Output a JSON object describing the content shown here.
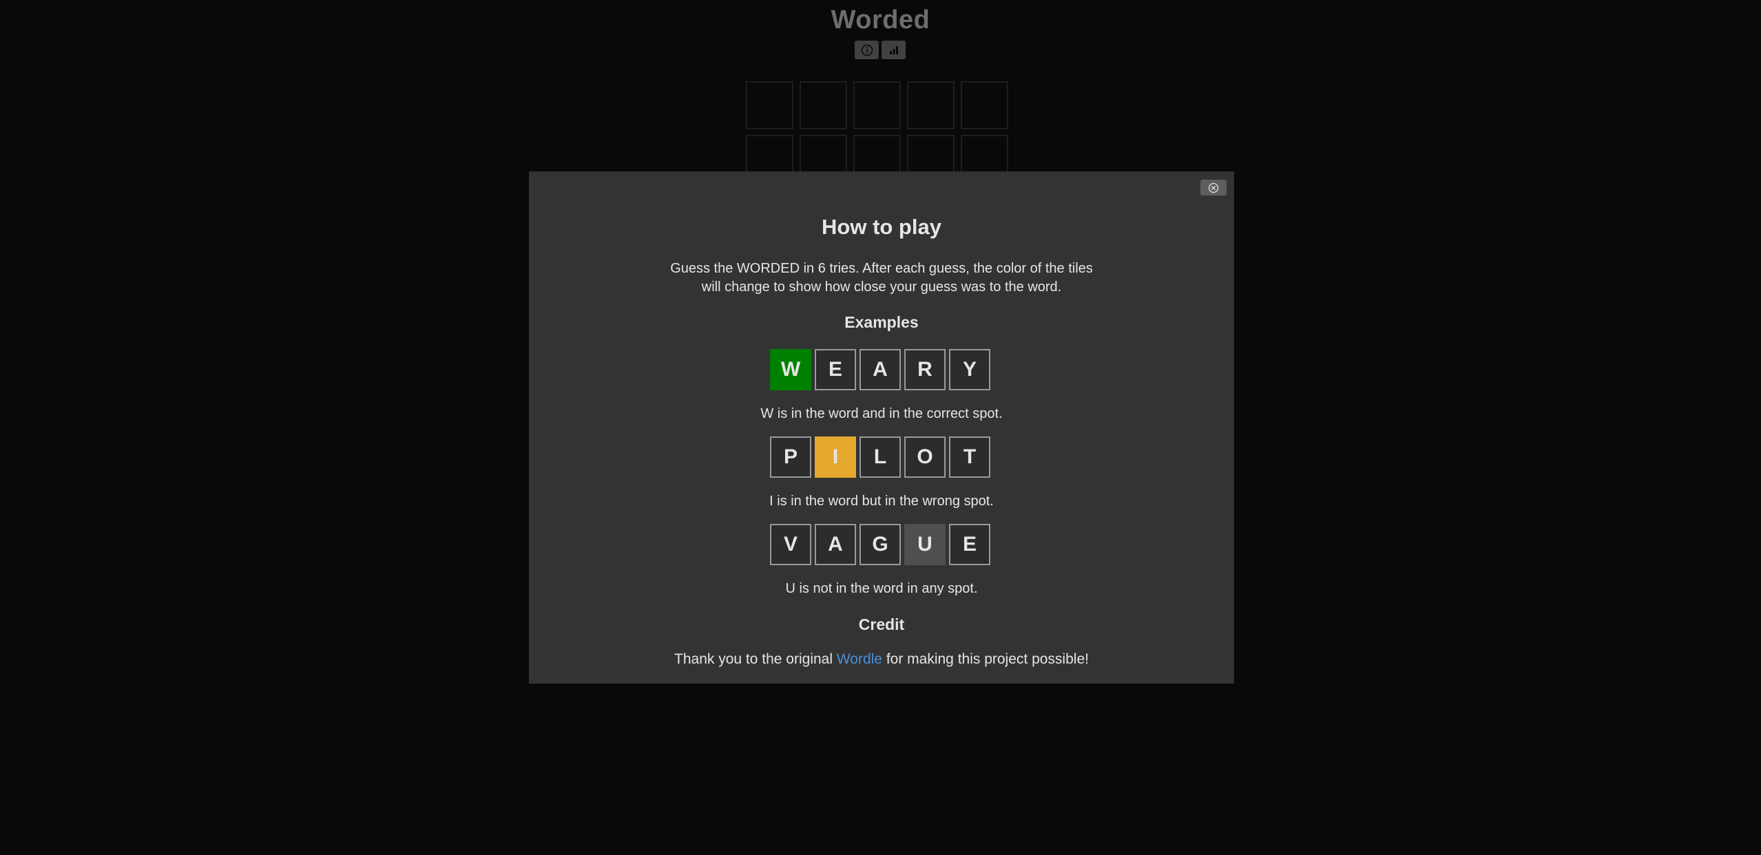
{
  "app": {
    "title": "Worded"
  },
  "header": {
    "info_icon": "info-circle-icon",
    "stats_icon": "bar-chart-icon"
  },
  "board": {
    "visible_rows": 2,
    "columns": 5
  },
  "modal": {
    "title": "How to play",
    "intro_line1": "Guess the WORDED in 6 tries. After each guess, the color of the tiles",
    "intro_line2": "will change to show how close your guess was to the word.",
    "examples_heading": "Examples",
    "examples": [
      {
        "letters": [
          "W",
          "E",
          "A",
          "R",
          "Y"
        ],
        "states": [
          "correct",
          "empty",
          "empty",
          "empty",
          "empty"
        ],
        "caption": "W is in the word and in the correct spot."
      },
      {
        "letters": [
          "P",
          "I",
          "L",
          "O",
          "T"
        ],
        "states": [
          "empty",
          "present",
          "empty",
          "empty",
          "empty"
        ],
        "caption": "I is in the word but in the wrong spot."
      },
      {
        "letters": [
          "V",
          "A",
          "G",
          "U",
          "E"
        ],
        "states": [
          "empty",
          "empty",
          "empty",
          "absent",
          "empty"
        ],
        "caption": "U is not in the word in any spot."
      }
    ],
    "credit_heading": "Credit",
    "credit_prefix": "Thank you to the original ",
    "credit_link": "Wordle",
    "credit_suffix": " for making this project possible!",
    "close_icon": "close-circle-icon"
  },
  "colors": {
    "correct": "#008000",
    "present": "#e5a82f",
    "absent": "#4f4f4f",
    "link": "#4a90d9"
  }
}
